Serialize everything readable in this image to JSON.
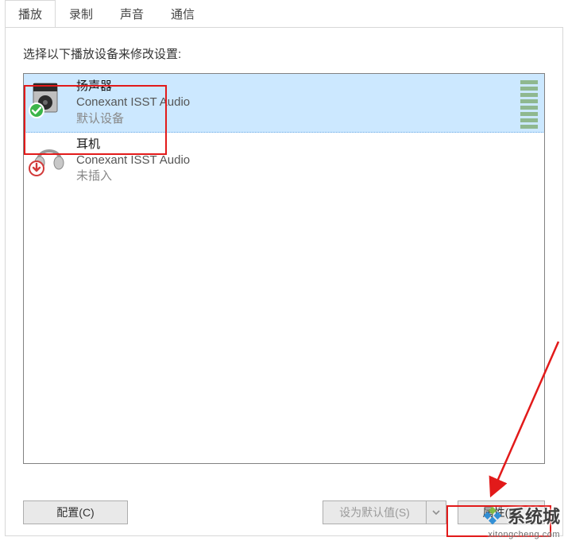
{
  "tabs": {
    "playback": "播放",
    "recording": "录制",
    "sounds": "声音",
    "communications": "通信"
  },
  "instruction": "选择以下播放设备来修改设置:",
  "devices": [
    {
      "name": "扬声器",
      "description": "Conexant ISST Audio",
      "status": "默认设备",
      "icon": "speaker",
      "badge": "check",
      "selected": true
    },
    {
      "name": "耳机",
      "description": "Conexant ISST Audio",
      "status": "未插入",
      "icon": "headphones",
      "badge": "down-red",
      "selected": false
    }
  ],
  "buttons": {
    "configure": "配置(C)",
    "set_default": "设为默认值(S)",
    "properties": "属性(P)"
  },
  "watermark": {
    "brand": "系统城",
    "url": "xitongcheng.com"
  }
}
